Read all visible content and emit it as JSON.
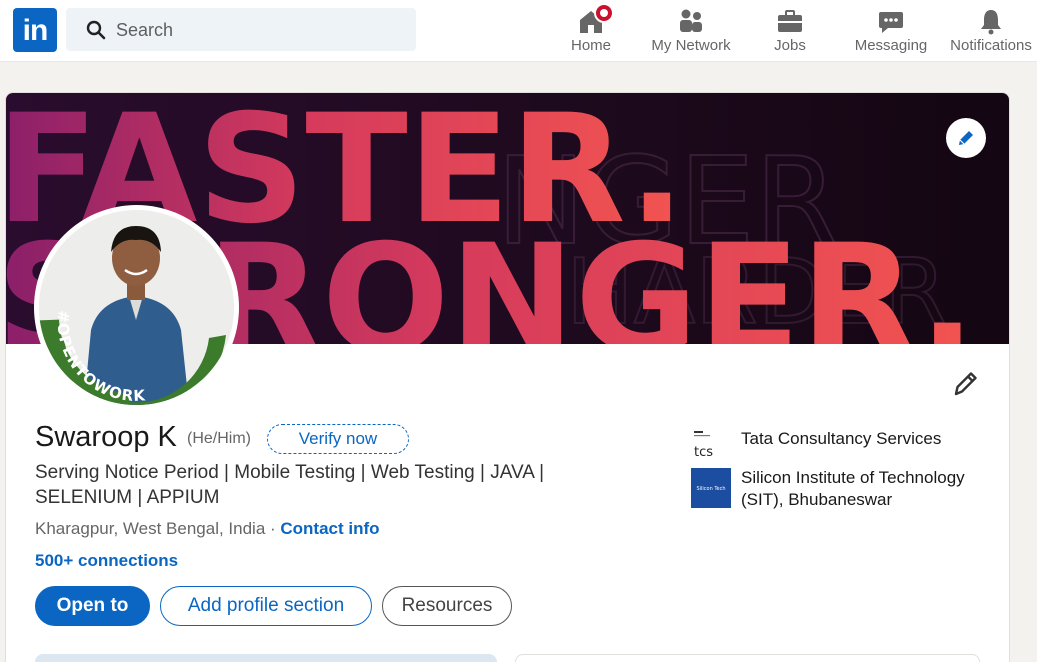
{
  "nav": {
    "logo_text": "in",
    "search_placeholder": "Search",
    "items": [
      {
        "label": "Home",
        "icon": "home-icon"
      },
      {
        "label": "My Network",
        "icon": "network-icon"
      },
      {
        "label": "Jobs",
        "icon": "briefcase-icon"
      },
      {
        "label": "Messaging",
        "icon": "chat-icon"
      },
      {
        "label": "Notifications",
        "icon": "bell-icon"
      }
    ]
  },
  "banner": {
    "line1": "FASTER.",
    "line2": "STRONGER."
  },
  "profile": {
    "name": "Swaroop K",
    "pronouns": "(He/Him)",
    "verify_label": "Verify now",
    "headline": "Serving Notice Period | Mobile Testing | Web Testing | JAVA | SELENIUM | APPIUM",
    "location": "Kharagpur, West Bengal, India",
    "separator": " · ",
    "contact_label": "Contact info",
    "connections": "500+ connections",
    "frame_text": "#OPENTOWORK"
  },
  "buttons": {
    "open_to": "Open to",
    "add_section": "Add profile section",
    "resources": "Resources"
  },
  "orgs": [
    {
      "name": "Tata Consultancy Services",
      "logo_text": "tcs"
    },
    {
      "name": "Silicon Institute of Technology (SIT), Bhubaneswar",
      "logo_text": "Silicon Tech"
    }
  ],
  "colors": {
    "brand": "#0a66c2",
    "badge": "#cb112d",
    "open_to_work_green": "#3c7a2c"
  }
}
